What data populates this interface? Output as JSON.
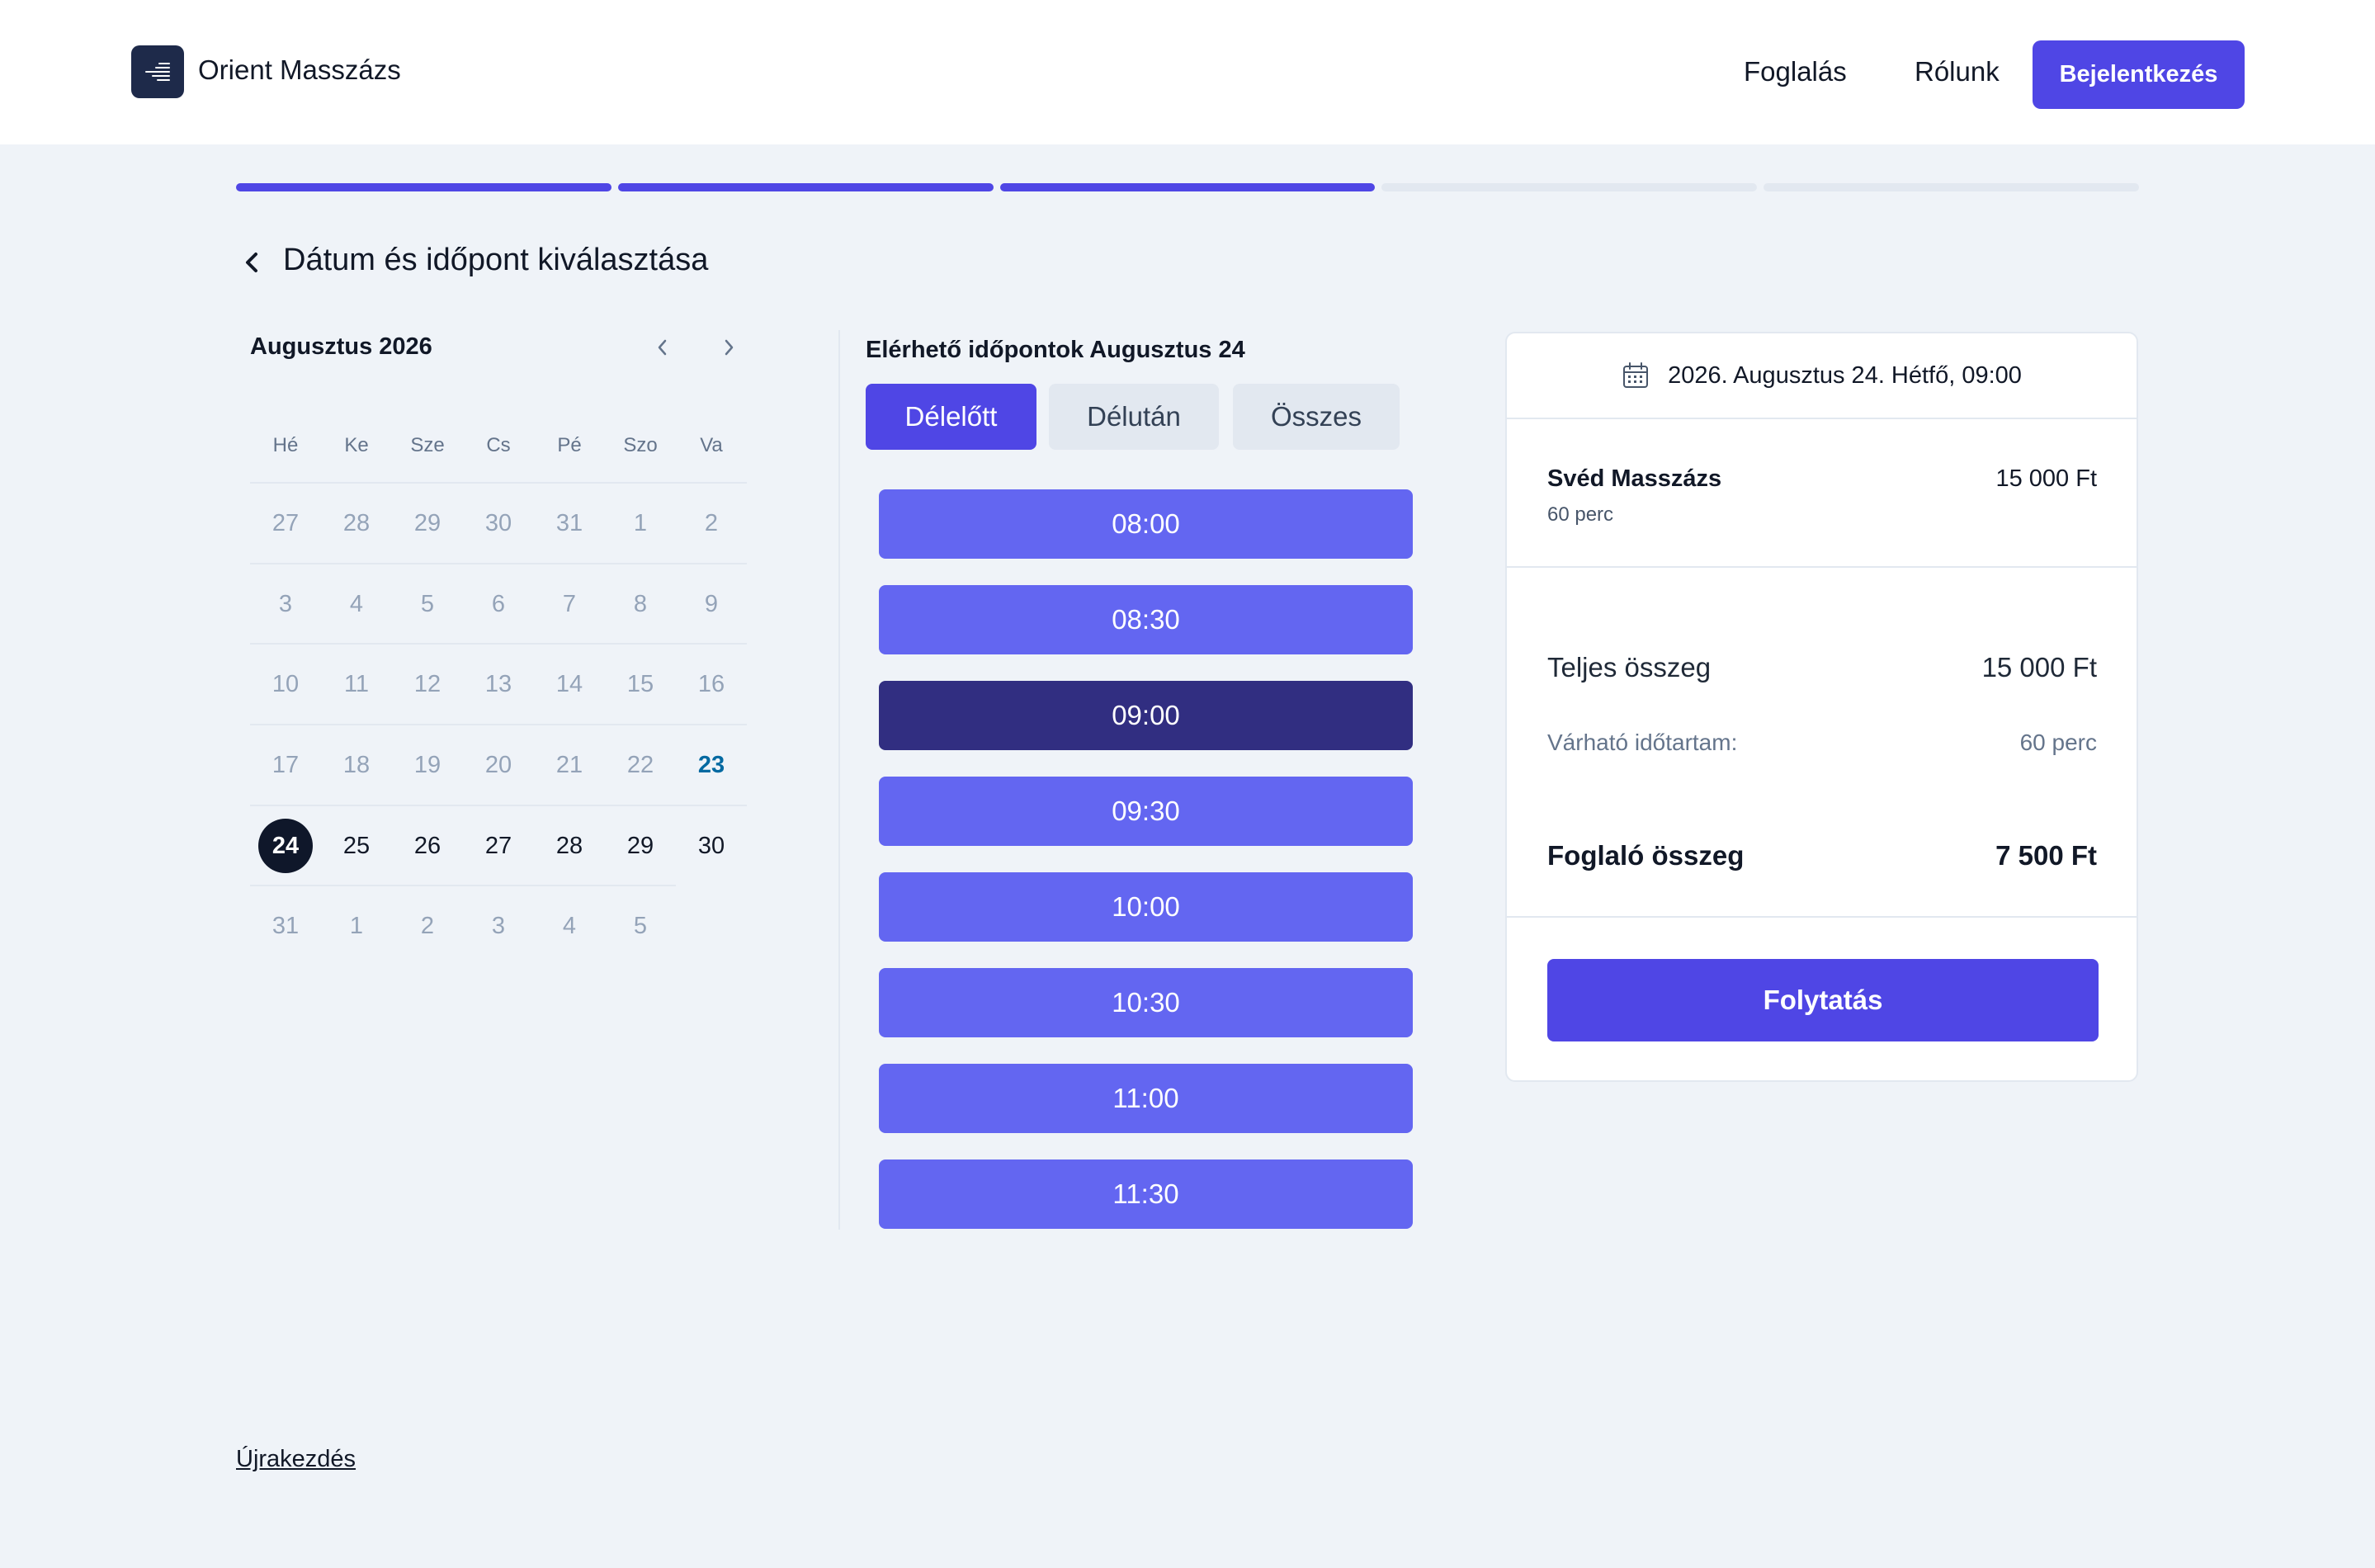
{
  "header": {
    "brand": "Orient Masszázs",
    "nav": {
      "booking": "Foglalás",
      "about": "Rólunk"
    },
    "login": "Bejelentkezés"
  },
  "progress": {
    "total_steps": 5,
    "completed_steps": 3
  },
  "page_title": "Dátum és időpont kiválasztása",
  "calendar": {
    "month": "Augusztus 2026",
    "weekdays": [
      "Hé",
      "Ke",
      "Sze",
      "Cs",
      "Pé",
      "Szo",
      "Va"
    ],
    "today": "23",
    "selected": "24",
    "weeks": [
      [
        "27",
        "28",
        "29",
        "30",
        "31",
        "1",
        "2"
      ],
      [
        "3",
        "4",
        "5",
        "6",
        "7",
        "8",
        "9"
      ],
      [
        "10",
        "11",
        "12",
        "13",
        "14",
        "15",
        "16"
      ],
      [
        "17",
        "18",
        "19",
        "20",
        "21",
        "22",
        "23"
      ],
      [
        "24",
        "25",
        "26",
        "27",
        "28",
        "29",
        "30"
      ],
      [
        "31",
        "1",
        "2",
        "3",
        "4",
        "5"
      ]
    ]
  },
  "slots": {
    "title": "Elérhető időpontok Augusztus 24",
    "tabs": [
      "Délelőtt",
      "Délután",
      "Összes"
    ],
    "active_tab": "Délelőtt",
    "times": [
      "08:00",
      "08:30",
      "09:00",
      "09:30",
      "10:00",
      "10:30",
      "11:00",
      "11:30"
    ],
    "selected": "09:00"
  },
  "summary": {
    "datetime": "2026. Augusztus 24. Hétfő, 09:00",
    "service_name": "Svéd Masszázs",
    "service_duration": "60 perc",
    "service_price": "15 000 Ft",
    "total_label": "Teljes összeg",
    "total_value": "15 000 Ft",
    "duration_label": "Várható időtartam:",
    "duration_value": "60 perc",
    "deposit_label": "Foglaló összeg",
    "deposit_value": "7 500 Ft",
    "continue": "Folytatás"
  },
  "restart": "Újrakezdés",
  "colors": {
    "primary": "#4f46e5",
    "slot": "#6366f1",
    "slot_selected": "#312e81",
    "background": "#eff3f8"
  }
}
